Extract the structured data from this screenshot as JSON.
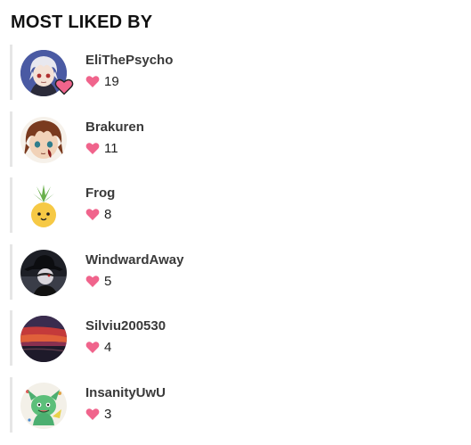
{
  "section": {
    "title": "MOST LIKED BY"
  },
  "colors": {
    "heart": "#f0648c",
    "rail": "#e6e6e6"
  },
  "users": [
    {
      "name": "EliThePsycho",
      "likes": "19",
      "avatar": "anime-white-hair-avatar",
      "badge": "heart-badge-icon"
    },
    {
      "name": "Brakuren",
      "likes": "11",
      "avatar": "anime-brown-hair-avatar"
    },
    {
      "name": "Frog",
      "likes": "8",
      "avatar": "pineapple-avatar"
    },
    {
      "name": "WindwardAway",
      "likes": "5",
      "avatar": "dark-hat-character-avatar"
    },
    {
      "name": "Silviu200530",
      "likes": "4",
      "avatar": "sunset-sky-avatar"
    },
    {
      "name": "InsanityUwU",
      "likes": "3",
      "avatar": "green-creature-avatar"
    }
  ]
}
